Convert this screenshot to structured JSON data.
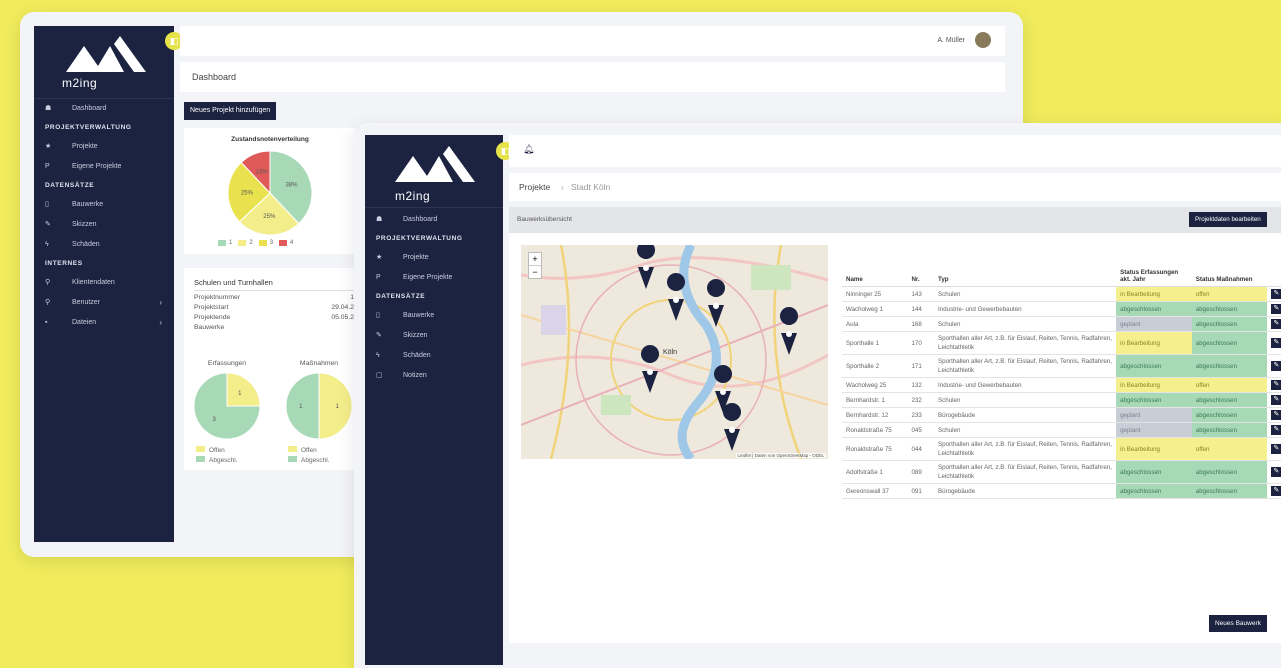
{
  "back": {
    "brand": "m2ing",
    "user": "A. Müller",
    "page_title": "Dashboard",
    "new_project_button": "Neues Projekt hinzufügen",
    "nav": [
      {
        "type": "item",
        "icon": "home-icon",
        "glyph": "☗",
        "label": "Dashboard"
      },
      {
        "type": "head",
        "label": "PROJEKTVERWALTUNG"
      },
      {
        "type": "item",
        "icon": "star-icon",
        "glyph": "★",
        "label": "Projekte"
      },
      {
        "type": "item",
        "icon": "p-icon",
        "glyph": "P",
        "label": "Eigene Projekte"
      },
      {
        "type": "head",
        "label": "DATENSÄTZE"
      },
      {
        "type": "item",
        "icon": "building-icon",
        "glyph": "▯",
        "label": "Bauwerke"
      },
      {
        "type": "item",
        "icon": "edit-icon",
        "glyph": "✎",
        "label": "Skizzen"
      },
      {
        "type": "item",
        "icon": "bolt-icon",
        "glyph": "ϟ",
        "label": "Schäden"
      },
      {
        "type": "head",
        "label": "INTERNES"
      },
      {
        "type": "item",
        "icon": "pin-icon",
        "glyph": "⚲",
        "label": "Klientendaten"
      },
      {
        "type": "item",
        "icon": "user-icon",
        "glyph": "⚲",
        "label": "Benutzer",
        "arrow": "›"
      },
      {
        "type": "item",
        "icon": "file-icon",
        "glyph": "▪",
        "label": "Dateien",
        "arrow": "›"
      }
    ],
    "distribution_chart": {
      "title": "Zustandsnotenverteilung",
      "slices": [
        {
          "label": "1",
          "value": 38,
          "text": "38%",
          "color": "#a8d9b7"
        },
        {
          "label": "2",
          "value": 25,
          "text": "25%",
          "color": "#f3ed8a"
        },
        {
          "label": "3",
          "value": 25,
          "text": "25%",
          "color": "#e9e24e"
        },
        {
          "label": "4",
          "value": 12,
          "text": "13%",
          "color": "#e05a5a"
        }
      ]
    },
    "project_card": {
      "title": "Schulen und Turnhallen",
      "rows": [
        {
          "label": "Projektnummer",
          "value": "1"
        },
        {
          "label": "Projektstart",
          "value": "29.04.2"
        },
        {
          "label": "Projektende",
          "value": "05.05.2"
        },
        {
          "label": "Bauwerke",
          "value": ""
        }
      ],
      "pies": [
        {
          "title": "Erfassungen",
          "offen": 1,
          "abgeschl": 3,
          "legend_offen": "Offen",
          "legend_abg": "Abgeschl."
        },
        {
          "title": "Maßnahmen",
          "offen": 1,
          "abgeschl": 1,
          "legend_offen": "Offen",
          "legend_abg": "Abgeschl."
        }
      ]
    }
  },
  "front": {
    "brand": "m2ing",
    "breadcrumb": {
      "root": "Projekte",
      "sep": "›",
      "current": "Stadt Köln"
    },
    "section_title": "Bauwerksübersicht",
    "edit_project_button": "Projektdaten bearbeiten",
    "new_building_button": "Neues Bauwerk",
    "nav": [
      {
        "type": "item",
        "icon": "home-icon",
        "glyph": "☗",
        "label": "Dashboard"
      },
      {
        "type": "head",
        "label": "PROJEKTVERWALTUNG"
      },
      {
        "type": "item",
        "icon": "star-icon",
        "glyph": "★",
        "label": "Projekte"
      },
      {
        "type": "item",
        "icon": "p-icon",
        "glyph": "P",
        "label": "Eigene Projekte"
      },
      {
        "type": "head",
        "label": "DATENSÄTZE"
      },
      {
        "type": "item",
        "icon": "building-icon",
        "glyph": "▯",
        "label": "Bauwerke"
      },
      {
        "type": "item",
        "icon": "edit-icon",
        "glyph": "✎",
        "label": "Skizzen"
      },
      {
        "type": "item",
        "icon": "bolt-icon",
        "glyph": "ϟ",
        "label": "Schäden"
      },
      {
        "type": "item",
        "icon": "note-icon",
        "glyph": "▢",
        "label": "Notizen"
      }
    ],
    "map": {
      "zoom_in": "+",
      "zoom_out": "−",
      "city_label": "Köln",
      "attribution": "Leaflet | Daten von OpenStreetMap - ODbL"
    },
    "table": {
      "headers": [
        "Name",
        "Nr.",
        "Typ",
        "Status Erfassungen akt. Jahr",
        "Status Maßnahmen"
      ],
      "rows": [
        {
          "name": "Ninninger 25",
          "nr": "143",
          "typ": "Schulen",
          "erf": "in Bearbeitung",
          "erf_s": "inb",
          "mas": "offen",
          "mas_s": "off"
        },
        {
          "name": "Wacholweg 1",
          "nr": "144",
          "typ": "Industrie- und Gewerbebauten",
          "erf": "abgeschlossen",
          "erf_s": "abg",
          "mas": "abgeschlossen",
          "mas_s": "abg"
        },
        {
          "name": "Aula",
          "nr": "168",
          "typ": "Schulen",
          "erf": "geplant",
          "erf_s": "gep",
          "mas": "abgeschlossen",
          "mas_s": "abg"
        },
        {
          "name": "Sporthalle 1",
          "nr": "170",
          "typ": "Sporthallen aller Art, z.B. für Eislauf, Reiten, Tennis, Radfahren, Leichtathletik",
          "erf": "in Bearbeitung",
          "erf_s": "inb",
          "mas": "abgeschlossen",
          "mas_s": "abg"
        },
        {
          "name": "Sporthalle 2",
          "nr": "171",
          "typ": "Sporthallen aller Art, z.B. für Eislauf, Reiten, Tennis, Radfahren, Leichtathletik",
          "erf": "abgeschlossen",
          "erf_s": "abg",
          "mas": "abgeschlossen",
          "mas_s": "abg"
        },
        {
          "name": "Wacholweg 25",
          "nr": "132",
          "typ": "Industrie- und Gewerbebauten",
          "erf": "in Bearbeitung",
          "erf_s": "inb",
          "mas": "offen",
          "mas_s": "off"
        },
        {
          "name": "Bernhardstr. 1",
          "nr": "232",
          "typ": "Schulen",
          "erf": "abgeschlossen",
          "erf_s": "abg",
          "mas": "abgeschlossen",
          "mas_s": "abg"
        },
        {
          "name": "Bernhardstr. 12",
          "nr": "233",
          "typ": "Bürogebäude",
          "erf": "geplant",
          "erf_s": "gep",
          "mas": "abgeschlossen",
          "mas_s": "abg"
        },
        {
          "name": "Ronaldstraße 75",
          "nr": "045",
          "typ": "Schulen",
          "erf": "geplant",
          "erf_s": "gep",
          "mas": "abgeschlossen",
          "mas_s": "abg"
        },
        {
          "name": "Ronaldstraße 75",
          "nr": "044",
          "typ": "Sporthallen aller Art, z.B. für Eislauf, Reiten, Tennis, Radfahren, Leichtathletik",
          "erf": "in Bearbeitung",
          "erf_s": "inb",
          "mas": "offen",
          "mas_s": "off"
        },
        {
          "name": "Adolfstraße 1",
          "nr": "089",
          "typ": "Sporthallen aller Art, z.B. für Eislauf, Reiten, Tennis, Radfahren, Leichtathletik",
          "erf": "abgeschlossen",
          "erf_s": "abg",
          "mas": "abgeschlossen",
          "mas_s": "abg"
        },
        {
          "name": "Gereonswall 37",
          "nr": "091",
          "typ": "Bürogebäude",
          "erf": "abgeschlossen",
          "erf_s": "abg",
          "mas": "abgeschlossen",
          "mas_s": "abg"
        }
      ]
    }
  },
  "colors": {
    "sidebar": "#1b2340",
    "accent": "#e6e24a",
    "background": "#f0ec5c"
  }
}
